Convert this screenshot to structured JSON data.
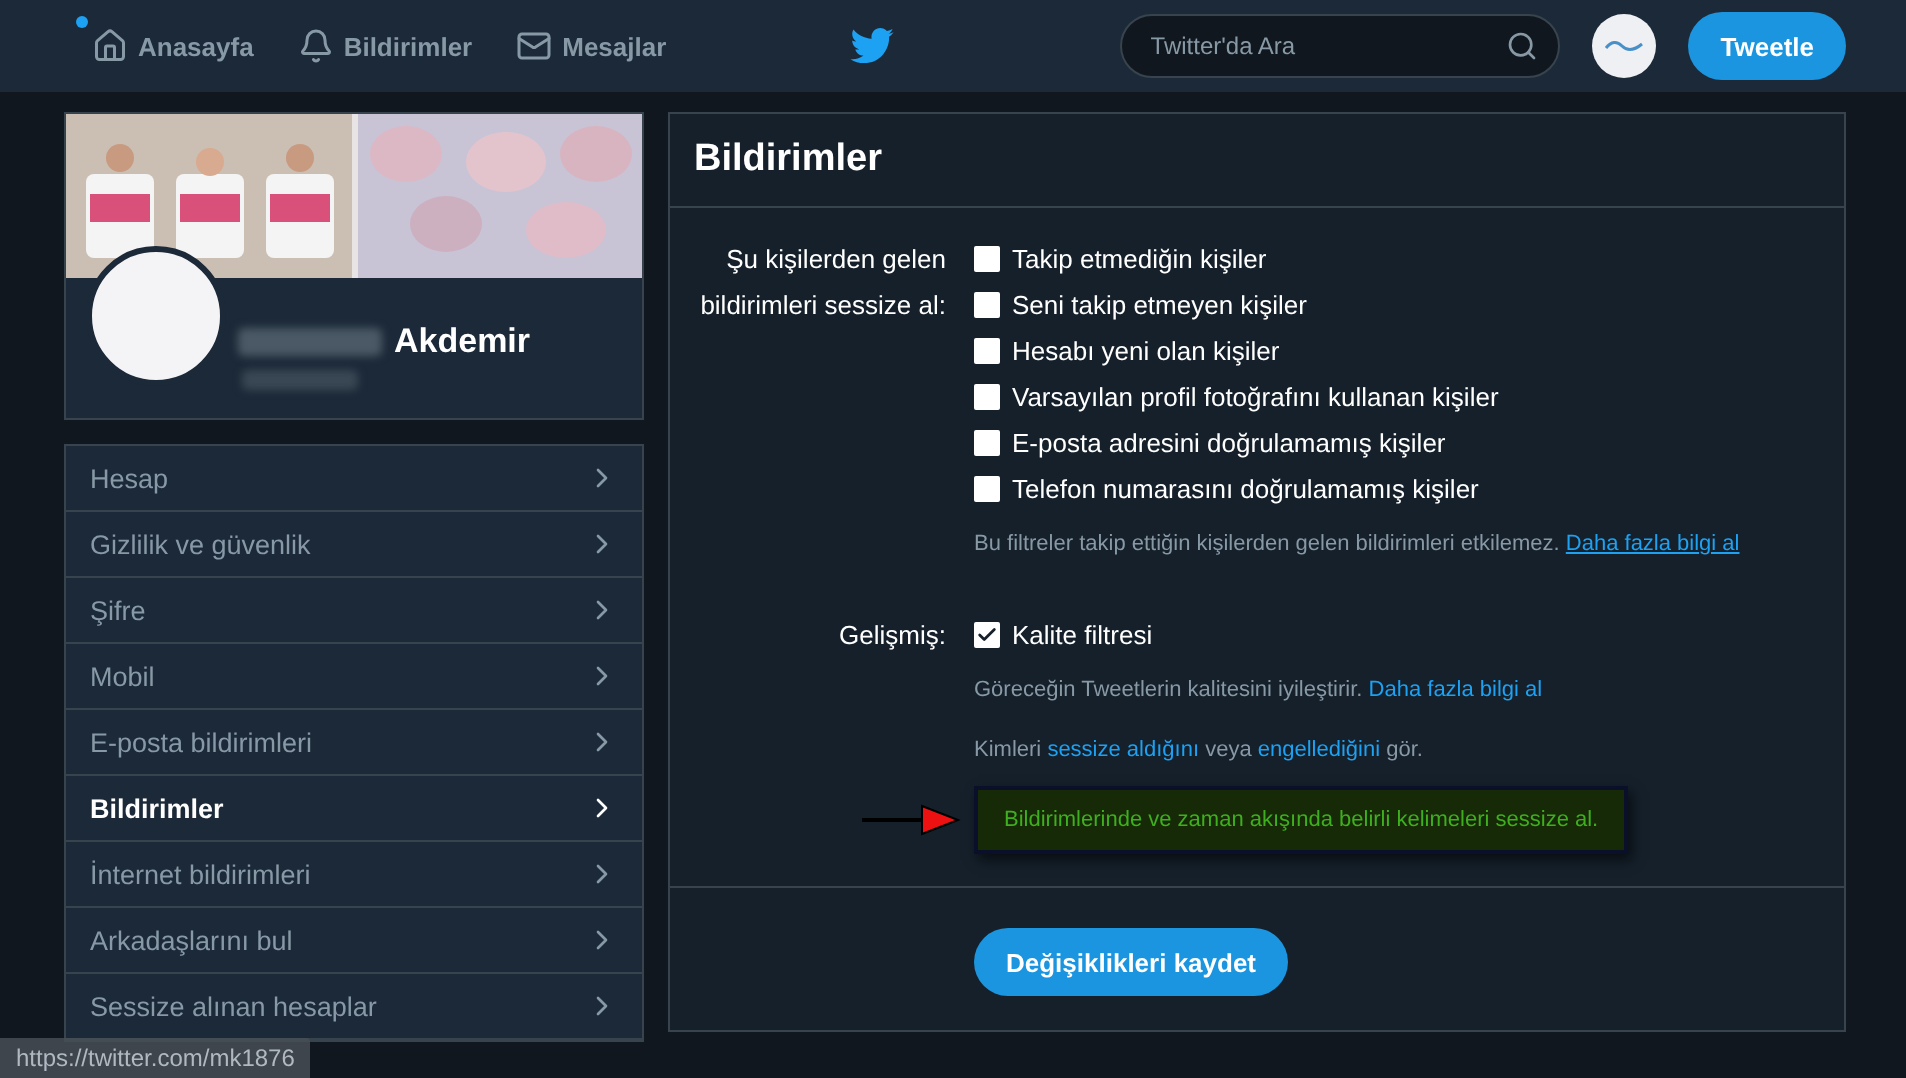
{
  "nav": {
    "items": [
      {
        "label": "Anasayfa",
        "kind": "home",
        "selected": false,
        "unread": true
      },
      {
        "label": "Bildirimler",
        "kind": "bell",
        "selected": false,
        "unread": false
      },
      {
        "label": "Mesajlar",
        "kind": "mail",
        "selected": false,
        "unread": false
      }
    ],
    "search": {
      "placeholder": "Twitter'da Ara"
    },
    "tweet_button": "Tweetle"
  },
  "profile": {
    "name": "Akdemir"
  },
  "menu": [
    {
      "label": "Hesap",
      "selected": false
    },
    {
      "label": "Gizlilik ve güvenlik",
      "selected": false
    },
    {
      "label": "Şifre",
      "selected": false
    },
    {
      "label": "Mobil",
      "selected": false
    },
    {
      "label": "E-posta bildirimleri",
      "selected": false
    },
    {
      "label": "Bildirimler",
      "selected": true
    },
    {
      "label": "İnternet bildirimleri",
      "selected": false
    },
    {
      "label": "Arkadaşlarını bul",
      "selected": false
    },
    {
      "label": "Sessize alınan hesaplar",
      "selected": false
    }
  ],
  "panel": {
    "title": "Bildirimler",
    "mute_label": "Şu kişilerden gelen bildirimleri sessize al:",
    "filters": [
      {
        "label": "Takip etmediğin kişiler",
        "checked": false
      },
      {
        "label": "Seni takip etmeyen kişiler",
        "checked": false
      },
      {
        "label": "Hesabı yeni olan kişiler",
        "checked": false
      },
      {
        "label": "Varsayılan profil fotoğrafını kullanan kişiler",
        "checked": false
      },
      {
        "label": "E-posta adresini doğrulamamış kişiler",
        "checked": false
      },
      {
        "label": "Telefon numarasını doğrulamamış kişiler",
        "checked": false
      }
    ],
    "filters_note": "Bu filtreler takip ettiğin kişilerden gelen bildirimleri etkilemez.",
    "filters_link": "Daha fazla bilgi al",
    "advanced_label": "Gelişmiş:",
    "advanced": [
      {
        "label": "Kalite filtresi",
        "checked": true
      }
    ],
    "quality_note": "Göreceğin Tweetlerin kalitesini iyileştirir.",
    "quality_link": "Daha fazla bilgi al",
    "see_parts": [
      "Kimleri",
      "sessize aldığını",
      "veya",
      "engellediğini",
      "gör."
    ],
    "muted_words_link": "Bildirimlerinde ve zaman akışında belirli kelimeleri sessize al.",
    "save_button": "Değişiklikleri kaydet"
  },
  "status_url": "https://twitter.com/mk1876"
}
